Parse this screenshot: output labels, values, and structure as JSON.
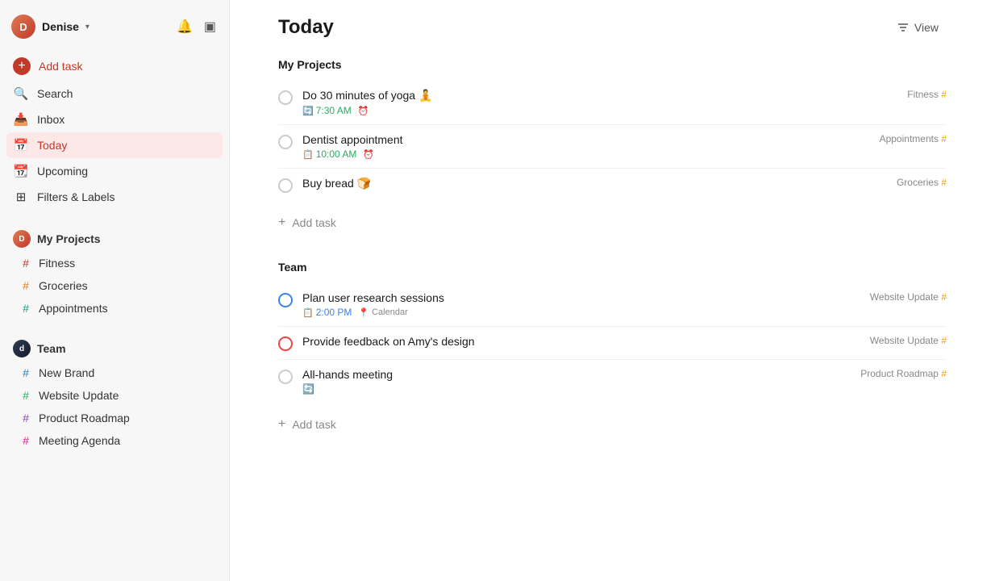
{
  "sidebar": {
    "user": {
      "name": "Denise"
    },
    "nav": [
      {
        "id": "add-task",
        "label": "Add task",
        "icon": "add",
        "type": "action"
      },
      {
        "id": "search",
        "label": "Search",
        "icon": "search"
      },
      {
        "id": "inbox",
        "label": "Inbox",
        "icon": "inbox"
      },
      {
        "id": "today",
        "label": "Today",
        "icon": "today",
        "active": true
      },
      {
        "id": "upcoming",
        "label": "Upcoming",
        "icon": "upcoming"
      },
      {
        "id": "filters",
        "label": "Filters & Labels",
        "icon": "filters"
      }
    ],
    "myProjects": {
      "label": "My Projects",
      "items": [
        {
          "id": "fitness",
          "label": "Fitness",
          "color": "red"
        },
        {
          "id": "groceries",
          "label": "Groceries",
          "color": "orange"
        },
        {
          "id": "appointments",
          "label": "Appointments",
          "color": "teal"
        }
      ]
    },
    "team": {
      "label": "Team",
      "items": [
        {
          "id": "new-brand",
          "label": "New Brand",
          "color": "blue"
        },
        {
          "id": "website-update",
          "label": "Website Update",
          "color": "green"
        },
        {
          "id": "product-roadmap",
          "label": "Product Roadmap",
          "color": "purple"
        },
        {
          "id": "meeting-agenda",
          "label": "Meeting Agenda",
          "color": "pink"
        }
      ]
    }
  },
  "main": {
    "title": "Today",
    "view_label": "View",
    "myProjects": {
      "section_title": "My Projects",
      "tasks": [
        {
          "id": "task-1",
          "title": "Do 30 minutes of yoga 🧘",
          "time": "7:30 AM",
          "time_color": "green",
          "has_reminder": true,
          "project": "Fitness",
          "checkbox_style": "default"
        },
        {
          "id": "task-2",
          "title": "Dentist appointment",
          "time": "10:00 AM",
          "time_color": "green",
          "has_reminder": true,
          "project": "Appointments",
          "checkbox_style": "default"
        },
        {
          "id": "task-3",
          "title": "Buy bread 🍞",
          "time": null,
          "project": "Groceries",
          "checkbox_style": "default"
        }
      ],
      "add_task_label": "Add task"
    },
    "team": {
      "section_title": "Team",
      "tasks": [
        {
          "id": "task-4",
          "title": "Plan user research sessions",
          "time": "2:00 PM",
          "time_color": "blue",
          "has_calendar": true,
          "calendar_label": "Calendar",
          "project": "Website Update",
          "checkbox_style": "blue"
        },
        {
          "id": "task-5",
          "title": "Provide feedback on Amy's design",
          "time": null,
          "project": "Website Update",
          "checkbox_style": "red"
        },
        {
          "id": "task-6",
          "title": "All-hands meeting",
          "time": null,
          "has_recur": true,
          "project": "Product Roadmap",
          "checkbox_style": "default"
        }
      ],
      "add_task_label": "Add task"
    }
  }
}
